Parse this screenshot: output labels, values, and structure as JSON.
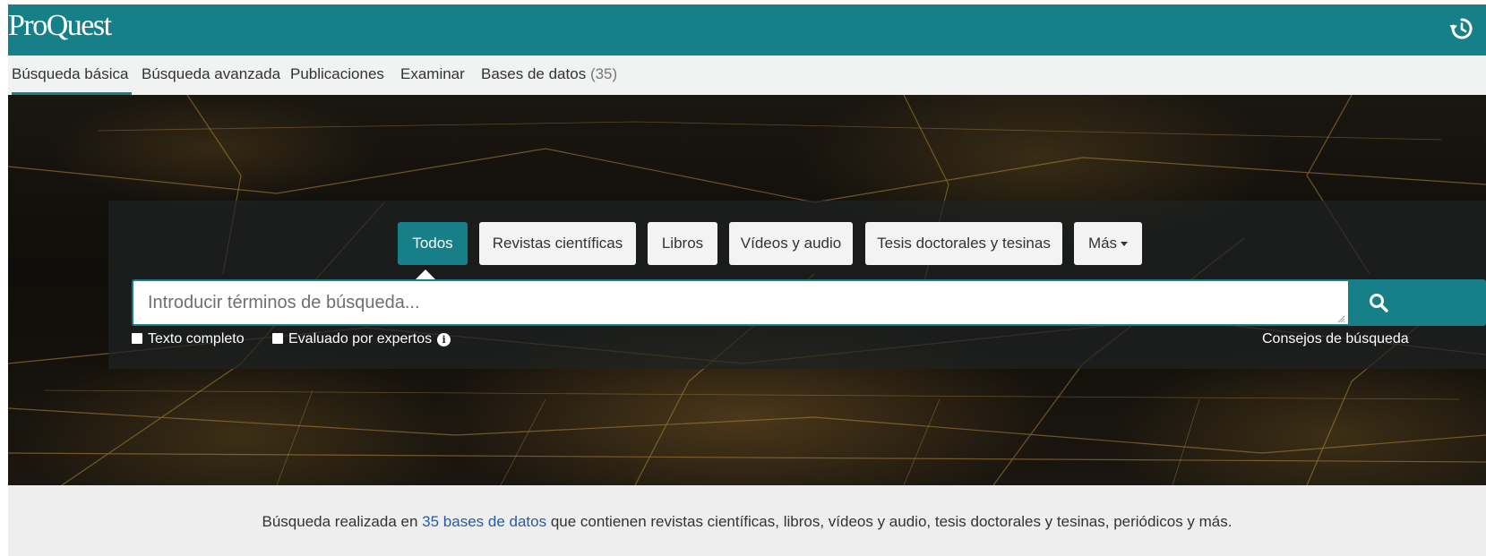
{
  "header": {
    "logo": "ProQuest",
    "history_icon": "history-icon",
    "brand_color": "#177f88"
  },
  "nav": {
    "items": [
      {
        "label": "Búsqueda básica",
        "active": true
      },
      {
        "label": "Búsqueda avanzada",
        "active": false
      },
      {
        "label": "Publicaciones",
        "active": false
      },
      {
        "label": "Examinar",
        "active": false
      },
      {
        "label": "Bases de datos",
        "count": "(35)",
        "active": false
      }
    ]
  },
  "search": {
    "tabs": [
      {
        "label": "Todos",
        "active": true
      },
      {
        "label": "Revistas científicas",
        "active": false
      },
      {
        "label": "Libros",
        "active": false
      },
      {
        "label": "Vídeos y audio",
        "active": false
      },
      {
        "label": "Tesis doctorales y tesinas",
        "active": false
      },
      {
        "label": "Más",
        "active": false
      }
    ],
    "placeholder": "Introducir términos de búsqueda...",
    "value": "",
    "search_icon": "search-icon",
    "options": {
      "full_text": "Texto completo",
      "peer_reviewed": "Evaluado por expertos",
      "full_text_checked": false,
      "peer_reviewed_checked": false
    },
    "tips": "Consejos de búsqueda"
  },
  "info": {
    "prefix": "Búsqueda realizada en ",
    "link": "35 bases de datos",
    "suffix": " que contienen revistas científicas, libros, vídeos y audio, tesis doctorales y tesinas, periódicos y más."
  }
}
